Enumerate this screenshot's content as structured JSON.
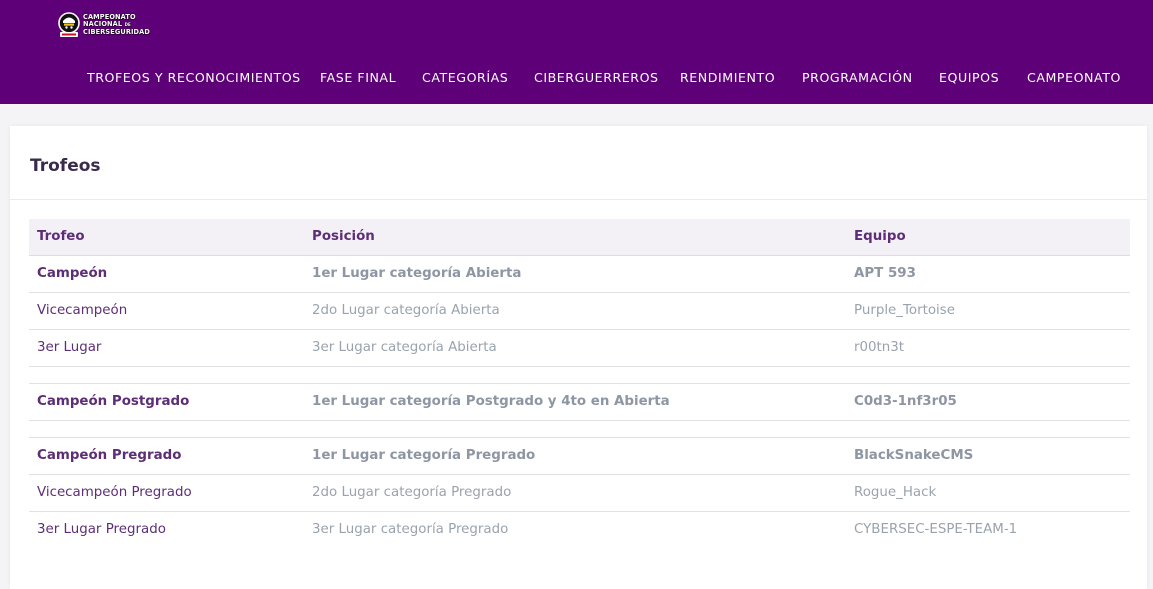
{
  "header": {
    "logo": {
      "line1": "CAMPEONATO",
      "line2": "NACIONAL",
      "line2_small": "DE",
      "line3": "CIBERSEGURIDAD"
    },
    "nav": [
      "TROFEOS Y RECONOCIMIENTOS",
      "FASE FINAL",
      "CATEGORÍAS",
      "CIBERGUERREROS",
      "RENDIMIENTO",
      "PROGRAMACIÓN",
      "EQUIPOS",
      "CAMPEONATO"
    ]
  },
  "card": {
    "title": "Trofeos",
    "columns": [
      "Trofeo",
      "Posición",
      "Equipo"
    ],
    "rows": [
      {
        "trofeo": "Campeón",
        "posicion": "1er Lugar categoría Abierta",
        "equipo": "APT 593"
      },
      {
        "trofeo": "Vicecampeón",
        "posicion": "2do Lugar categoría Abierta",
        "equipo": "Purple_Tortoise"
      },
      {
        "trofeo": "3er Lugar",
        "posicion": "3er Lugar categoría Abierta",
        "equipo": "r00tn3t"
      },
      {
        "trofeo": "Campeón Postgrado",
        "posicion": "1er Lugar categoría Postgrado y 4to en Abierta",
        "equipo": "C0d3-1nf3r05"
      },
      {
        "trofeo": "Campeón Pregrado",
        "posicion": "1er Lugar categoría Pregrado",
        "equipo": "BlackSnakeCMS"
      },
      {
        "trofeo": "Vicecampeón Pregrado",
        "posicion": "2do Lugar categoría Pregrado",
        "equipo": "Rogue_Hack"
      },
      {
        "trofeo": "3er Lugar Pregrado",
        "posicion": "3er Lugar categoría Pregrado",
        "equipo": "CYBERSEC-ESPE-TEAM-1"
      }
    ]
  },
  "colors": {
    "header_bg": "#5e0078",
    "accent_text": "#5d2e76",
    "muted_text": "#9aa3ad"
  }
}
